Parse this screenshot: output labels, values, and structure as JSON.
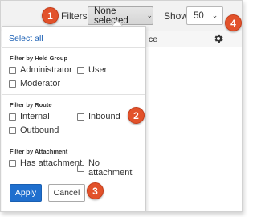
{
  "toolbar": {
    "filters_label": "Filters",
    "filters_value": "None selected",
    "show_label": "Show",
    "show_value": "50"
  },
  "table": {
    "column_fragment": "ce"
  },
  "dropdown": {
    "select_all": "Select all",
    "sections": [
      {
        "title": "Filter by Held Group",
        "options": [
          "Administrator",
          "User",
          "Moderator"
        ]
      },
      {
        "title": "Filter by Route",
        "options": [
          "Internal",
          "Inbound",
          "Outbound"
        ]
      },
      {
        "title": "Filter by Attachment",
        "options": [
          "Has attachment",
          "No attachment"
        ]
      }
    ],
    "apply_label": "Apply",
    "cancel_label": "Cancel"
  },
  "callouts": [
    "1",
    "2",
    "3",
    "4"
  ],
  "colors": {
    "accent": "#1f6fce",
    "link": "#1a5fb4",
    "callout": "#e2522b"
  },
  "icons": {
    "gear": "gear-icon",
    "chevron": "chevron-down-icon"
  }
}
